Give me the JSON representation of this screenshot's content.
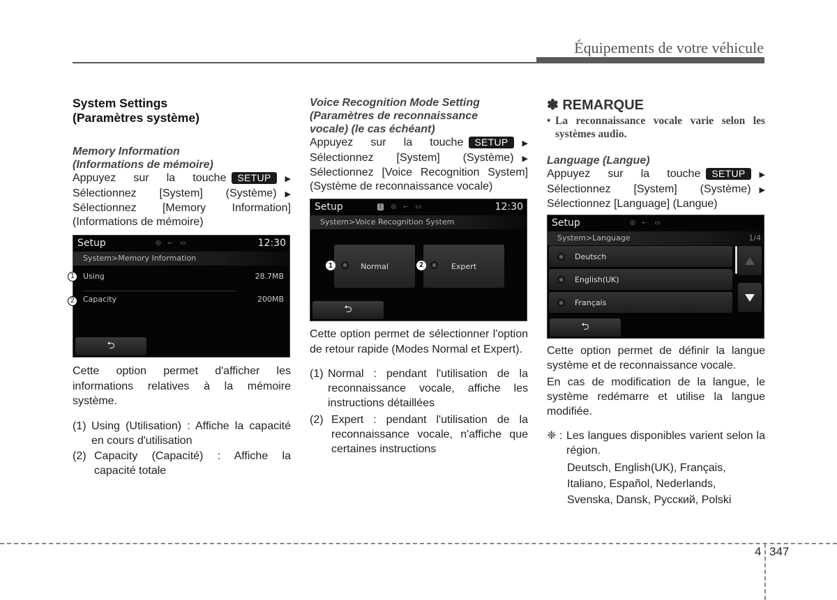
{
  "header": {
    "title": "Équipements de votre véhicule"
  },
  "footer": {
    "chapter": "4",
    "page": "347"
  },
  "setup_key": "SETUP",
  "arrow": "▶",
  "col1": {
    "heading_line1": "System Settings",
    "heading_line2": "(Paramètres système)",
    "sub_line1": "Memory Information",
    "sub_line2": "(Informations de mémoire)",
    "instr1": "Appuyez sur la touche",
    "instr2": "Sélectionnez [System] (Système)",
    "instr3": "Sélectionnez [Memory Information]",
    "instr4": "(Informations de mémoire)",
    "screen": {
      "title": "Setup",
      "time": "12:30",
      "breadcrumb": "System>Memory Information",
      "rows": [
        {
          "callout": "1",
          "label": "Using",
          "value": "28.7MB"
        },
        {
          "callout": "2",
          "label": "Capacity",
          "value": "200MB"
        }
      ],
      "back": "⮌"
    },
    "desc": "Cette option permet d'afficher les informations relatives à la mémoire système.",
    "items": [
      {
        "num": "(1)",
        "text": "Using (Utilisation) : Affiche la capacité en cours d'utilisation"
      },
      {
        "num": "(2)",
        "text": "Capacity (Capacité) : Affiche la capacité totale"
      }
    ]
  },
  "col2": {
    "sub_line1": "Voice Recognition Mode Setting",
    "sub_line2": "(Paramètres de reconnaissance",
    "sub_line3": "vocale) (le cas échéant)",
    "instr1": "Appuyez sur la touche",
    "instr2": "Sélectionnez [System] (Système)",
    "instr3": "Sélectionnez [Voice Recognition System]",
    "instr4": "(Système de reconnaissance vocale)",
    "screen": {
      "title": "Setup",
      "time": "12:30",
      "breadcrumb": "System>Voice Recognition System",
      "modes": [
        {
          "callout": "1",
          "label": "Normal"
        },
        {
          "callout": "2",
          "label": "Expert"
        }
      ],
      "back": "⮌"
    },
    "desc": "Cette option permet de sélectionner l'option de retour rapide (Modes Normal et Expert).",
    "items": [
      {
        "num": "(1)",
        "text": "Normal : pendant l'utilisation de la reconnaissance vocale, affiche les instructions détaillées"
      },
      {
        "num": "(2)",
        "text": "Expert : pendant l'utilisation de la reconnaissance vocale, n'affiche que certaines instructions"
      }
    ]
  },
  "col3": {
    "remark_title": "✽ REMARQUE",
    "remark_text": "La reconnaissance vocale varie selon les systèmes audio.",
    "sub_line1": "Language (Langue)",
    "instr1": "Appuyez sur la touche",
    "instr2": "Sélectionnez [System] (Système)",
    "instr3": "Sélectionnez [Language] (Langue)",
    "screen": {
      "title": "Setup",
      "breadcrumb": "System>Language",
      "page_indicator": "1/4",
      "languages": [
        "Deutsch",
        "English(UK)",
        "Français"
      ],
      "back": "⮌"
    },
    "desc1": "Cette option permet de définir la langue système et de reconnaissance vocale.",
    "desc2": "En cas de modification de la langue, le système redémarre et utilise la langue modifiée.",
    "note_symbol": "❈ :",
    "note_text": "Les langues disponibles varient selon la région.",
    "lang_list_1": "Deutsch, English(UK), Français,",
    "lang_list_2": "Italiano, Español, Nederlands,",
    "lang_list_3": "Svenska, Dansk, Русский, Polski"
  }
}
